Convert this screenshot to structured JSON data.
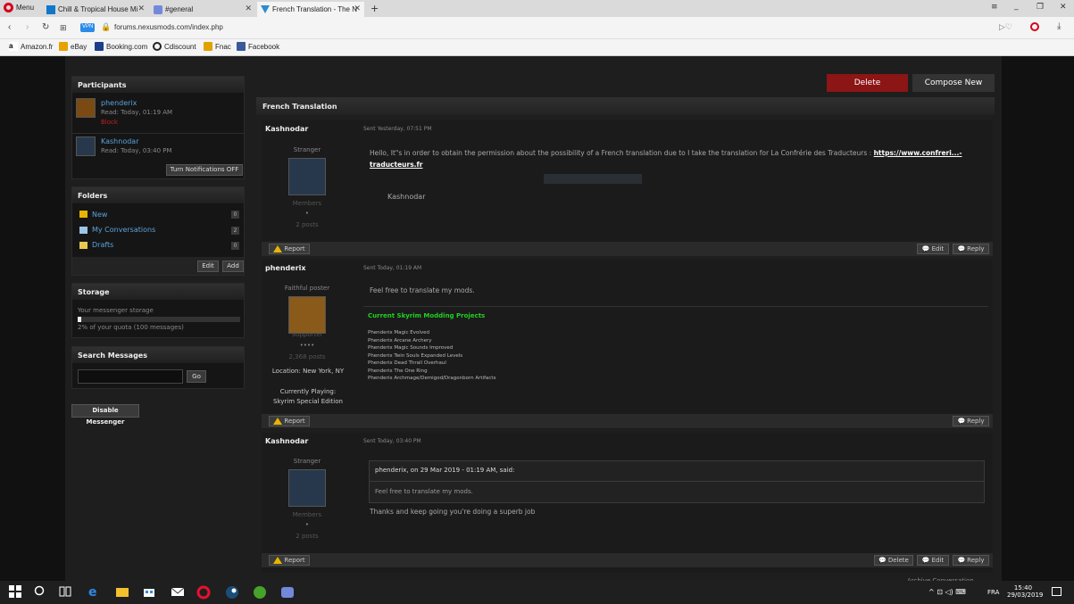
{
  "browser": {
    "menu_label": "Menu",
    "tabs": [
      {
        "label": "Chill & Tropical House Mi"
      },
      {
        "label": "#general"
      },
      {
        "label": "French Translation - The N"
      }
    ],
    "address": "forums.nexusmods.com/index.php",
    "vpn_label": "VPN",
    "bookmarks": [
      "Amazon.fr",
      "eBay",
      "Booking.com",
      "Cdiscount",
      "Fnac",
      "Facebook"
    ]
  },
  "actions": {
    "delete_label": "Delete",
    "compose_label": "Compose New"
  },
  "participants": {
    "title": "Participants",
    "items": [
      {
        "name": "phenderix",
        "read": "Read: Today, 01:19 AM",
        "block": "Block"
      },
      {
        "name": "Kashnodar",
        "read": "Read: Today, 03:40 PM"
      }
    ],
    "notif_button": "Turn Notifications OFF"
  },
  "folders": {
    "title": "Folders",
    "items": [
      {
        "label": "New",
        "count": "0"
      },
      {
        "label": "My Conversations",
        "count": "2"
      },
      {
        "label": "Drafts",
        "count": "0"
      }
    ],
    "edit": "Edit",
    "add": "Add"
  },
  "storage": {
    "title": "Storage",
    "label": "Your messenger storage",
    "quota": "2% of your quota (100 messages)",
    "fill_percent": 2
  },
  "search": {
    "title": "Search Messages",
    "go": "Go",
    "value": ""
  },
  "disable_label": "Disable Messenger",
  "conversation": {
    "title": "French Translation",
    "posts": [
      {
        "author": "Kashnodar",
        "sent": "Sent Yesterday, 07:51 PM",
        "rank": "Stranger",
        "group": "Members",
        "pips": "•",
        "posts": "2 posts",
        "body": "Hello, It\"s in order to obtain the permission about the possibility of a French translation due to I take the translation for La Confrérie des Traducteurs :",
        "link": "https://www.confreri...-traducteurs.fr",
        "signature": "Kashnodar",
        "report": "Report",
        "edit": "Edit",
        "reply": "Reply"
      },
      {
        "author": "phenderix",
        "sent": "Sent Today, 01:19 AM",
        "rank": "Faithful poster",
        "group": "Supporter",
        "pips": "••••",
        "posts": "2,368 posts",
        "location": "Location: New York, NY",
        "playing_label": "Currently Playing:",
        "playing": "Skyrim Special Edition",
        "body": "Feel free to translate my mods.",
        "sig_title": "Current Skyrim Modding Projects",
        "sig_lines": [
          "Phenderix Magic Evolved",
          "Phenderix Arcane Archery",
          "Phenderix Magic Sounds Improved",
          "Phenderix Twin Souls Expanded Levels",
          "Phenderix Dead Thrall Overhaul",
          "Phenderix The One Ring",
          "Phenderix Archmage/Demigod/Dragonborn Artifacts"
        ],
        "report": "Report",
        "reply": "Reply"
      },
      {
        "author": "Kashnodar",
        "sent": "Sent Today, 03:40 PM",
        "rank": "Stranger",
        "group": "Members",
        "pips": "•",
        "posts": "2 posts",
        "quote_head": "phenderix, on 29 Mar 2019 - 01:19 AM, said:",
        "quote_body": "Feel free to translate my mods.",
        "body": "Thanks and keep going you're doing a superb job",
        "report": "Report",
        "delete": "Delete",
        "edit": "Edit",
        "reply": "Reply"
      }
    ],
    "archive": "Archive Conversation"
  },
  "taskbar": {
    "lang": "FRA",
    "time": "15:40",
    "date": "29/03/2019"
  }
}
